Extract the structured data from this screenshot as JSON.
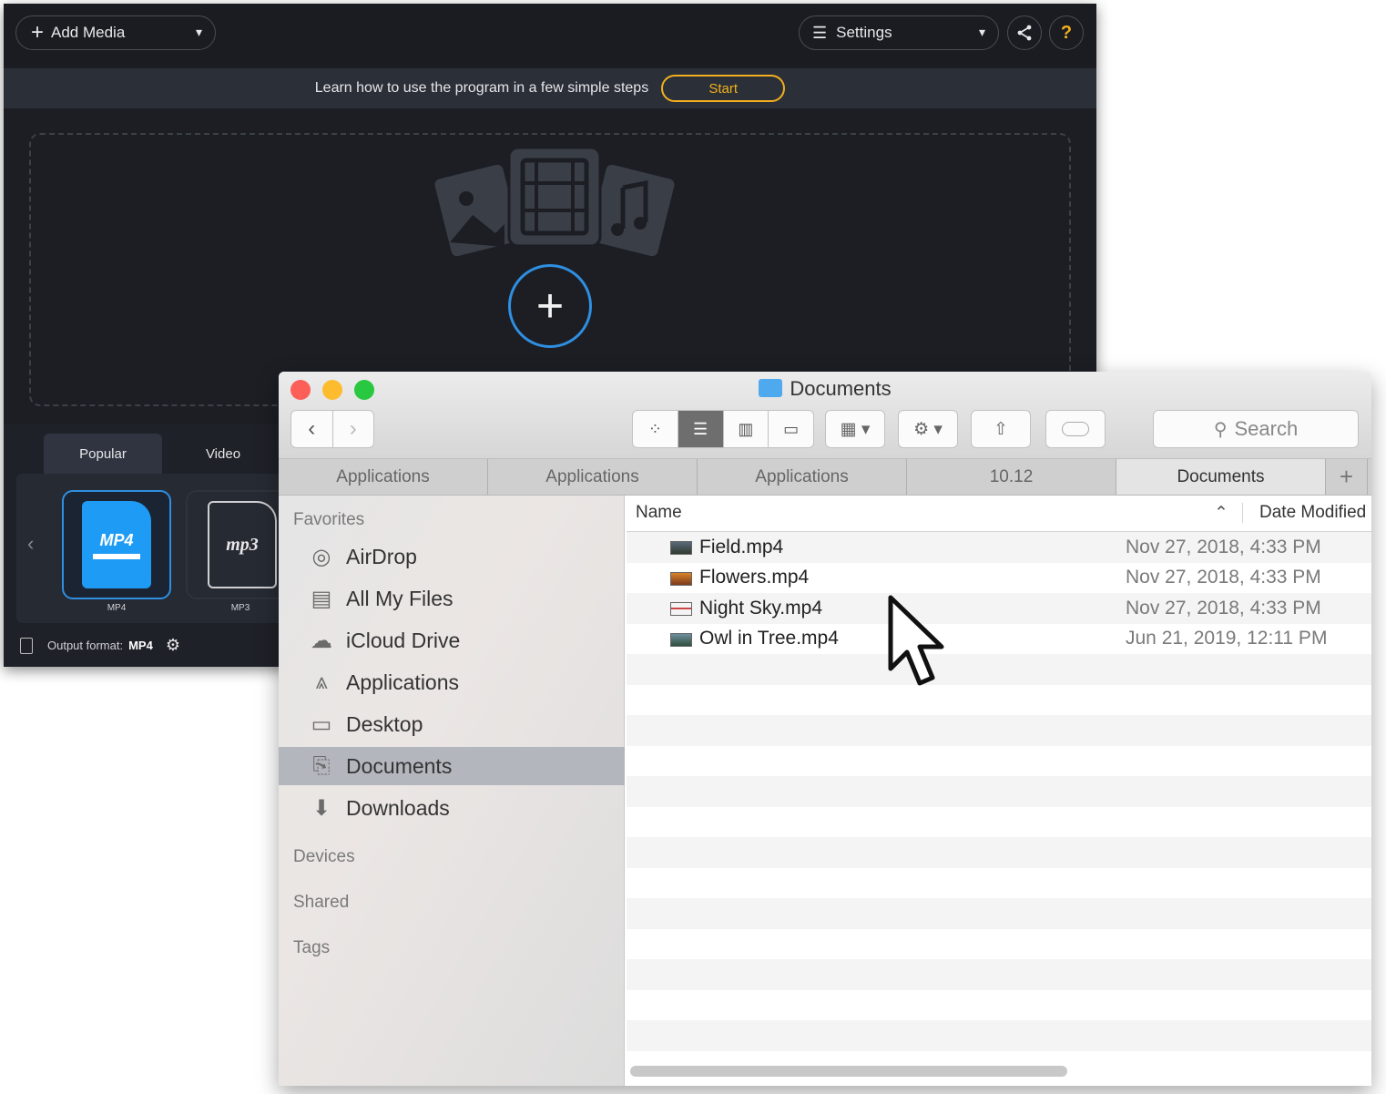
{
  "app": {
    "add_media": "Add Media",
    "settings": "Settings",
    "learn_text": "Learn how to use the program in a few simple steps",
    "start": "Start",
    "tabs": [
      "Popular",
      "Video"
    ],
    "formats": [
      {
        "label": "MP4",
        "badge": "MP4"
      },
      {
        "label": "MP3",
        "badge": "mp3"
      }
    ],
    "output_label": "Output format:",
    "output_value": "MP4",
    "accent_color": "#2f8fe0",
    "highlight_color": "#f2b01e"
  },
  "finder": {
    "title": "Documents",
    "search_placeholder": "Search",
    "path": [
      "Applications",
      "Applications",
      "Applications",
      "10.12",
      "Documents"
    ],
    "sidebar": {
      "favorites_heading": "Favorites",
      "items": [
        {
          "label": "AirDrop",
          "icon": "airdrop-icon"
        },
        {
          "label": "All My Files",
          "icon": "all-files-icon"
        },
        {
          "label": "iCloud Drive",
          "icon": "cloud-icon"
        },
        {
          "label": "Applications",
          "icon": "applications-icon"
        },
        {
          "label": "Desktop",
          "icon": "desktop-icon"
        },
        {
          "label": "Documents",
          "icon": "documents-icon",
          "selected": true
        },
        {
          "label": "Downloads",
          "icon": "downloads-icon"
        }
      ],
      "devices_heading": "Devices",
      "shared_heading": "Shared",
      "tags_heading": "Tags"
    },
    "columns": {
      "name": "Name",
      "date": "Date Modified"
    },
    "files": [
      {
        "name": "Field.mp4",
        "date": "Nov 27, 2018, 4:33 PM"
      },
      {
        "name": "Flowers.mp4",
        "date": "Nov 27, 2018, 4:33 PM"
      },
      {
        "name": "Night Sky.mp4",
        "date": "Nov 27, 2018, 4:33 PM"
      },
      {
        "name": "Owl in Tree.mp4",
        "date": "Jun 21, 2019, 12:11 PM"
      }
    ]
  }
}
